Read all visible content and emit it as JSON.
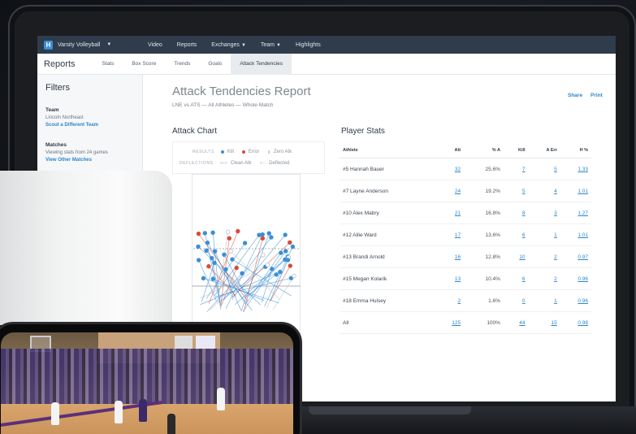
{
  "topnav": {
    "team": "Varsity Volleyball",
    "items": [
      "Video",
      "Reports",
      "Exchanges",
      "Team",
      "Highlights"
    ]
  },
  "subnav": {
    "title": "Reports",
    "tabs": [
      "Stats",
      "Box Score",
      "Trends",
      "Goals",
      "Attack Tendencies"
    ],
    "active_tab": "Attack Tendencies"
  },
  "sidebar": {
    "heading": "Filters",
    "team_title": "Team",
    "team_value": "Lincoln Northeast",
    "team_link": "Scout a Different Team",
    "matches_title": "Matches",
    "matches_value": "Viewing stats from 24 games",
    "matches_link": "View Other Matches"
  },
  "report": {
    "title": "Attack Tendencies Report",
    "subtitle": "LNE vs ATS — All Athletes — Whole Match",
    "share": "Share",
    "print": "Print"
  },
  "attack_chart": {
    "title": "Attack Chart",
    "results_label": "RESULTS",
    "kill": "Kill",
    "error": "Error",
    "zero_atk": "Zero Atk",
    "deflections_label": "DEFLECTIONS",
    "clean_atk": "Clean Atk",
    "deflected": "Deflected",
    "colors": {
      "kill": "#3a8fd6",
      "error": "#d64b3a",
      "zero": "#b9c0c7"
    }
  },
  "player_stats": {
    "title": "Player Stats",
    "headers": [
      "Athlete",
      "Att",
      "% A",
      "Kill",
      "A Err",
      "H %"
    ],
    "rows": [
      [
        "#5 Hannah Bauer",
        "32",
        "25.6%",
        "7",
        "5",
        "1.33"
      ],
      [
        "#7 Layne Anderson",
        "24",
        "19.2%",
        "5",
        "4",
        "1.01"
      ],
      [
        "#10 Alex Mabry",
        "21",
        "16.8%",
        "8",
        "3",
        "1.27"
      ],
      [
        "#12 Allie Ward",
        "17",
        "13.6%",
        "6",
        "1",
        "1.01"
      ],
      [
        "#13 Brandi Arnold",
        "16",
        "12.8%",
        "10",
        "2",
        "0.97"
      ],
      [
        "#15 Megan Kolarik",
        "13",
        "10.4%",
        "6",
        "2",
        "0.96"
      ],
      [
        "#18 Emma Hulsey",
        "2",
        "1.6%",
        "0",
        "1",
        "0.96"
      ],
      [
        "All",
        "125",
        "100%",
        "44",
        "15",
        "0.98"
      ]
    ]
  }
}
